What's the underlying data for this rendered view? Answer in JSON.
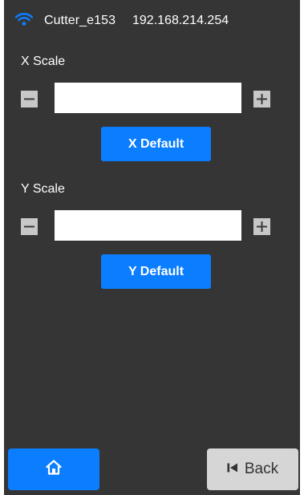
{
  "status": {
    "device_name": "Cutter_e153",
    "ip_address": "192.168.214.254",
    "wifi_icon": "wifi-icon"
  },
  "x_scale": {
    "label": "X Scale",
    "value": "",
    "decrement_icon": "minus-icon",
    "increment_icon": "plus-icon",
    "default_label": "X Default"
  },
  "y_scale": {
    "label": "Y Scale",
    "value": "",
    "decrement_icon": "minus-icon",
    "increment_icon": "plus-icon",
    "default_label": "Y Default"
  },
  "footer": {
    "home_icon": "home-icon",
    "back_icon": "skip-back-icon",
    "back_label": "Back"
  },
  "colors": {
    "background": "#353535",
    "accent": "#0b7dff",
    "stepper": "#c8c8c8",
    "secondary_button": "#d6d6d6"
  }
}
